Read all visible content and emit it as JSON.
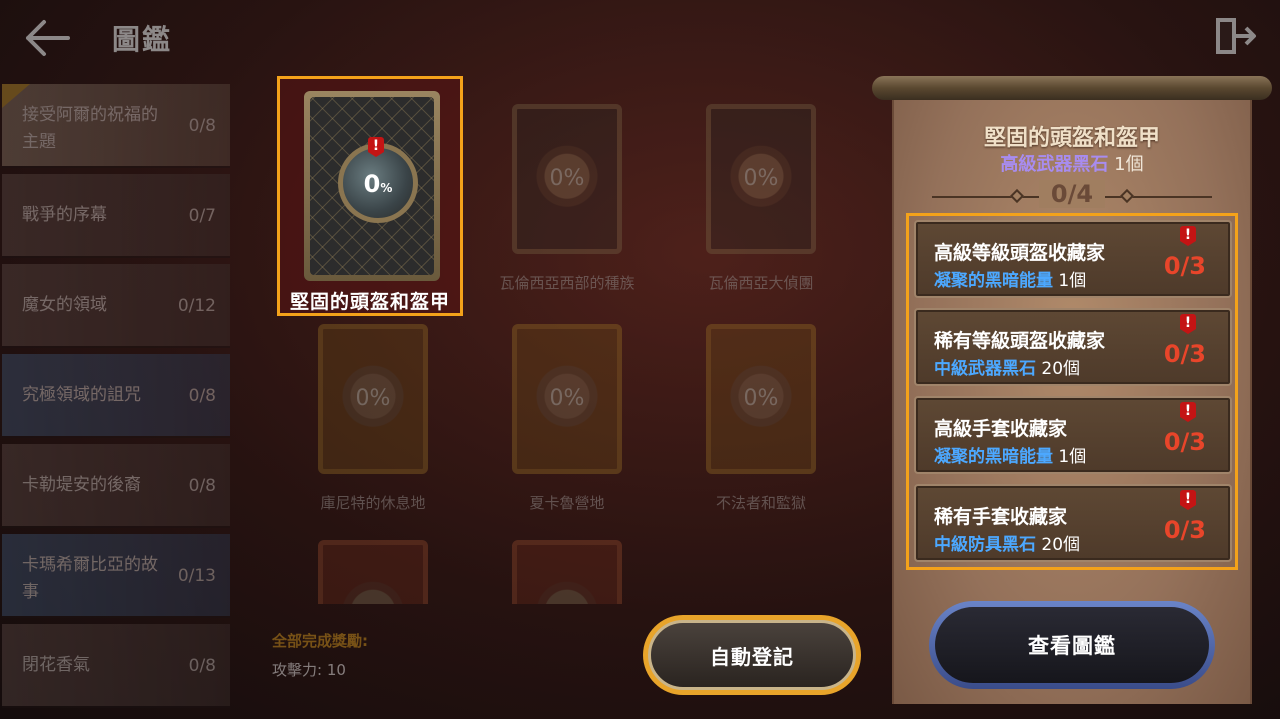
{
  "header": {
    "title": "圖鑑",
    "back_icon": "arrow-left-icon",
    "exit_icon": "exit-door-icon"
  },
  "sidebar": {
    "items": [
      {
        "label": "接受阿爾的祝福的主題",
        "count": "0/8",
        "state": "active"
      },
      {
        "label": "戰爭的序幕",
        "count": "0/7"
      },
      {
        "label": "魔女的領域",
        "count": "0/12"
      },
      {
        "label": "究極領域的詛咒",
        "count": "0/8",
        "state": "blue"
      },
      {
        "label": "卡勒堤安的後裔",
        "count": "0/8"
      },
      {
        "label": "卡瑪希爾比亞的故事",
        "count": "0/13"
      },
      {
        "label": "閉花香氣",
        "count": "0/8"
      }
    ]
  },
  "selected_card": {
    "name": "堅固的頭盔和盔甲",
    "percent": "0",
    "percent_unit": "%"
  },
  "grid_cards": [
    {
      "name": "瓦倫西亞西部的種族",
      "percent": "0%",
      "style": "dark"
    },
    {
      "name": "瓦倫西亞大偵團",
      "percent": "0%",
      "style": "dark"
    },
    {
      "name": "庫尼特的休息地",
      "percent": "0%",
      "style": "gold"
    },
    {
      "name": "夏卡魯營地",
      "percent": "0%",
      "style": "gold"
    },
    {
      "name": "不法者和監獄",
      "percent": "0%",
      "style": "gold"
    },
    {
      "name": "",
      "percent": "",
      "style": "red"
    },
    {
      "name": "",
      "percent": "",
      "style": "red"
    }
  ],
  "reward": {
    "title": "全部完成獎勵:",
    "value": "攻擊力: 10"
  },
  "auto_button": {
    "label": "自動登記"
  },
  "detail": {
    "title": "堅固的頭盔和盔甲",
    "sub_item": "高級武器黑石",
    "sub_qty": "1個",
    "progress": "0/4",
    "tasks": [
      {
        "title": "高級等級頭盔收藏家",
        "req_item": "凝聚的黑暗能量",
        "req_qty": "1個",
        "count": "0/3"
      },
      {
        "title": "稀有等級頭盔收藏家",
        "req_item": "中級武器黑石",
        "req_qty": "20個",
        "count": "0/3"
      },
      {
        "title": "高級手套收藏家",
        "req_item": "凝聚的黑暗能量",
        "req_qty": "1個",
        "count": "0/3"
      },
      {
        "title": "稀有手套收藏家",
        "req_item": "中級防具黑石",
        "req_qty": "20個",
        "count": "0/3"
      }
    ],
    "view_button": "查看圖鑑"
  },
  "colors": {
    "highlight": "#f4a21a",
    "purple_item": "#a88cf0",
    "blue_item": "#4ca8ff",
    "count_red": "#e8452a"
  }
}
